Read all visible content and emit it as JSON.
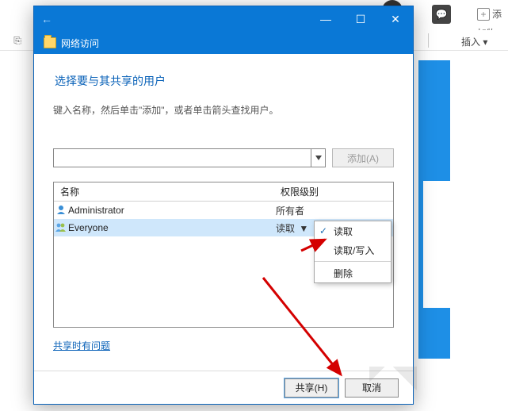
{
  "background": {
    "chat_icon": "💬",
    "add_label": "添加物",
    "insert_label": "插入 ▾"
  },
  "titlebar": {
    "min": "—",
    "max": "☐",
    "close": "✕"
  },
  "header": {
    "back": "←",
    "title": "网络访问"
  },
  "content": {
    "heading": "选择要与其共享的用户",
    "instruction": "键入名称，然后单击\"添加\"，或者单击箭头查找用户。",
    "input_value": "",
    "add_button": "添加(A)"
  },
  "list": {
    "col_name": "名称",
    "col_perm": "权限级别",
    "rows": [
      {
        "icon": "user",
        "name": "Administrator",
        "perm": "所有者",
        "dropdown": false,
        "selected": false
      },
      {
        "icon": "group",
        "name": "Everyone",
        "perm": "读取",
        "dropdown": true,
        "selected": true
      }
    ]
  },
  "context_menu": {
    "items": [
      {
        "label": "读取",
        "checked": true
      },
      {
        "label": "读取/写入",
        "checked": false
      }
    ],
    "separator": true,
    "footer_item": {
      "label": "删除",
      "checked": false
    }
  },
  "links": {
    "troubleshoot": "共享时有问题"
  },
  "footer": {
    "share": "共享(H)",
    "cancel": "取消"
  }
}
